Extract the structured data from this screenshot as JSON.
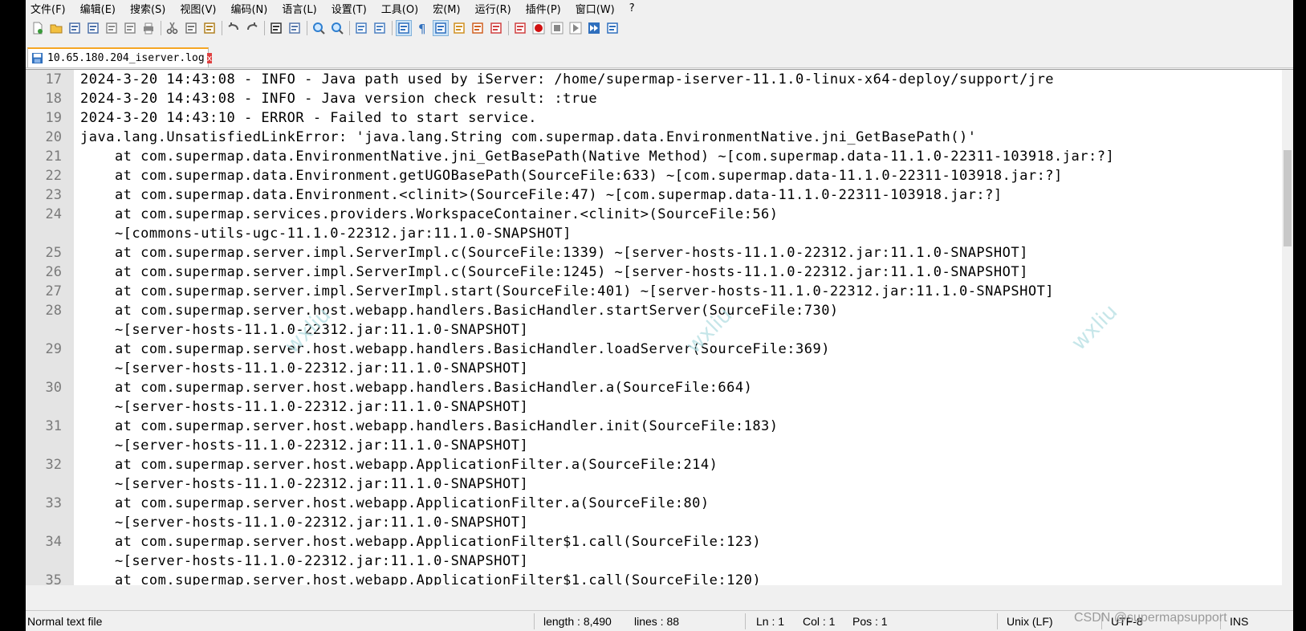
{
  "menu": [
    "文件(F)",
    "编辑(E)",
    "搜索(S)",
    "视图(V)",
    "编码(N)",
    "语言(L)",
    "设置(T)",
    "工具(O)",
    "宏(M)",
    "运行(R)",
    "插件(P)",
    "窗口(W)",
    "?"
  ],
  "toolbar_icons": [
    "new-file-icon",
    "open-file-icon",
    "save-icon",
    "save-all-icon",
    "close-icon",
    "close-all-icon",
    "print-icon",
    "cut-icon",
    "copy-icon",
    "paste-icon",
    "undo-icon",
    "redo-icon",
    "find-icon",
    "replace-icon",
    "zoom-in-icon",
    "zoom-out-icon",
    "sync-vertical-icon",
    "sync-horizontal-icon",
    "word-wrap-icon",
    "show-all-chars-icon",
    "indent-guide-icon",
    "doc-map-icon",
    "function-list-icon",
    "folder-workspace-icon",
    "monitor-icon",
    "record-macro-icon",
    "stop-macro-icon",
    "play-macro-icon",
    "run-macro-multiple-icon",
    "save-macro-icon"
  ],
  "tab": {
    "label": "10.65.180.204_iserver.log",
    "close": "x"
  },
  "lines": [
    {
      "n": "17",
      "text": "2024-3-20 14:43:08 - INFO - Java path used by iServer: /home/supermap-iserver-11.1.0-linux-x64-deploy/support/jre"
    },
    {
      "n": "18",
      "text": "2024-3-20 14:43:08 - INFO - Java version check result: :true"
    },
    {
      "n": "19",
      "text": "2024-3-20 14:43:10 - ERROR - Failed to start service."
    },
    {
      "n": "20",
      "text": "java.lang.UnsatisfiedLinkError: 'java.lang.String com.supermap.data.EnvironmentNative.jni_GetBasePath()'"
    },
    {
      "n": "21",
      "text": "    at com.supermap.data.EnvironmentNative.jni_GetBasePath(Native Method) ~[com.supermap.data-11.1.0-22311-103918.jar:?]"
    },
    {
      "n": "22",
      "text": "    at com.supermap.data.Environment.getUGOBasePath(SourceFile:633) ~[com.supermap.data-11.1.0-22311-103918.jar:?]"
    },
    {
      "n": "23",
      "text": "    at com.supermap.data.Environment.<clinit>(SourceFile:47) ~[com.supermap.data-11.1.0-22311-103918.jar:?]"
    },
    {
      "n": "24",
      "text": "    at com.supermap.services.providers.WorkspaceContainer.<clinit>(SourceFile:56)"
    },
    {
      "n": "",
      "text": "    ~[commons-utils-ugc-11.1.0-22312.jar:11.1.0-SNAPSHOT]"
    },
    {
      "n": "25",
      "text": "    at com.supermap.server.impl.ServerImpl.c(SourceFile:1339) ~[server-hosts-11.1.0-22312.jar:11.1.0-SNAPSHOT]"
    },
    {
      "n": "26",
      "text": "    at com.supermap.server.impl.ServerImpl.c(SourceFile:1245) ~[server-hosts-11.1.0-22312.jar:11.1.0-SNAPSHOT]"
    },
    {
      "n": "27",
      "text": "    at com.supermap.server.impl.ServerImpl.start(SourceFile:401) ~[server-hosts-11.1.0-22312.jar:11.1.0-SNAPSHOT]"
    },
    {
      "n": "28",
      "text": "    at com.supermap.server.host.webapp.handlers.BasicHandler.startServer(SourceFile:730)"
    },
    {
      "n": "",
      "text": "    ~[server-hosts-11.1.0-22312.jar:11.1.0-SNAPSHOT]"
    },
    {
      "n": "29",
      "text": "    at com.supermap.server.host.webapp.handlers.BasicHandler.loadServer(SourceFile:369)"
    },
    {
      "n": "",
      "text": "    ~[server-hosts-11.1.0-22312.jar:11.1.0-SNAPSHOT]"
    },
    {
      "n": "30",
      "text": "    at com.supermap.server.host.webapp.handlers.BasicHandler.a(SourceFile:664)"
    },
    {
      "n": "",
      "text": "    ~[server-hosts-11.1.0-22312.jar:11.1.0-SNAPSHOT]"
    },
    {
      "n": "31",
      "text": "    at com.supermap.server.host.webapp.handlers.BasicHandler.init(SourceFile:183)"
    },
    {
      "n": "",
      "text": "    ~[server-hosts-11.1.0-22312.jar:11.1.0-SNAPSHOT]"
    },
    {
      "n": "32",
      "text": "    at com.supermap.server.host.webapp.ApplicationFilter.a(SourceFile:214)"
    },
    {
      "n": "",
      "text": "    ~[server-hosts-11.1.0-22312.jar:11.1.0-SNAPSHOT]"
    },
    {
      "n": "33",
      "text": "    at com.supermap.server.host.webapp.ApplicationFilter.a(SourceFile:80)"
    },
    {
      "n": "",
      "text": "    ~[server-hosts-11.1.0-22312.jar:11.1.0-SNAPSHOT]"
    },
    {
      "n": "34",
      "text": "    at com.supermap.server.host.webapp.ApplicationFilter$1.call(SourceFile:123)"
    },
    {
      "n": "",
      "text": "    ~[server-hosts-11.1.0-22312.jar:11.1.0-SNAPSHOT]"
    },
    {
      "n": "35",
      "text": "    at com.supermap.server.host.webapp.ApplicationFilter$1.call(SourceFile:120)"
    }
  ],
  "watermark": "wxliu",
  "status": {
    "filetype": "Normal text file",
    "length": "length : 8,490",
    "lines": "lines : 88",
    "ln": "Ln : 1",
    "col": "Col : 1",
    "pos": "Pos : 1",
    "eol": "Unix (LF)",
    "encoding": "UTF-8",
    "mode": "INS",
    "overlay": "CSDN @supermapsupport"
  }
}
